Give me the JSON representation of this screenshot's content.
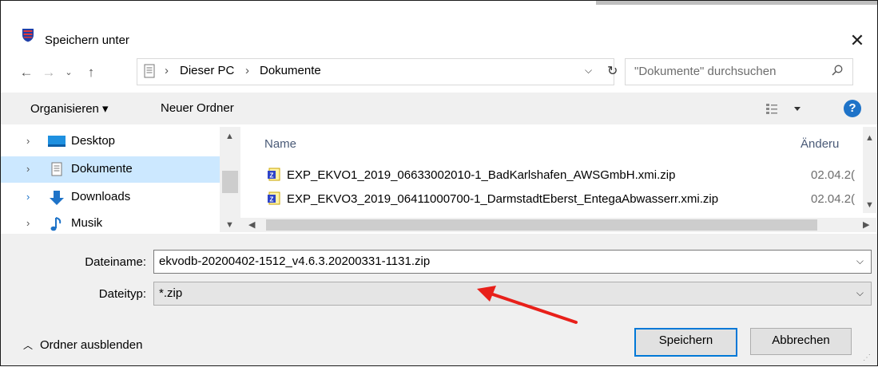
{
  "window": {
    "title": "Speichern unter",
    "close_glyph": "✕"
  },
  "address_bar": {
    "crumbs": [
      "Dieser PC",
      "Dokumente"
    ],
    "separator": "›",
    "search_placeholder": "\"Dokumente\" durchsuchen"
  },
  "toolbar": {
    "organize": "Organisieren ▾",
    "new_folder": "Neuer Ordner"
  },
  "nav_pane": {
    "items": [
      {
        "label": "Desktop",
        "icon": "desktop-icon"
      },
      {
        "label": "Dokumente",
        "icon": "documents-icon",
        "selected": true
      },
      {
        "label": "Downloads",
        "icon": "downloads-icon"
      },
      {
        "label": "Musik",
        "icon": "music-icon"
      }
    ]
  },
  "file_list": {
    "columns": {
      "name": "Name",
      "modified": "Änderu"
    },
    "rows": [
      {
        "name": "EXP_EKVO1_2019_06633002010-1_BadKarlshafen_AWSGmbH.xmi.zip",
        "date": "02.04.2("
      },
      {
        "name": "EXP_EKVO3_2019_06411000700-1_DarmstadtEberst_EntegaAbwasserr.xmi.zip",
        "date": "02.04.2("
      }
    ]
  },
  "form": {
    "filename_label": "Dateiname:",
    "filename_value": "ekvodb-20200402-1512_v4.6.3.20200331-1131.zip",
    "filetype_label": "Dateityp:",
    "filetype_value": "*.zip",
    "hide_folders": "Ordner ausblenden",
    "save_label": "Speichern",
    "cancel_label": "Abbrechen"
  },
  "colors": {
    "accent": "#0078d7",
    "selection": "#cce8ff",
    "annotation_arrow": "#e8201a"
  }
}
